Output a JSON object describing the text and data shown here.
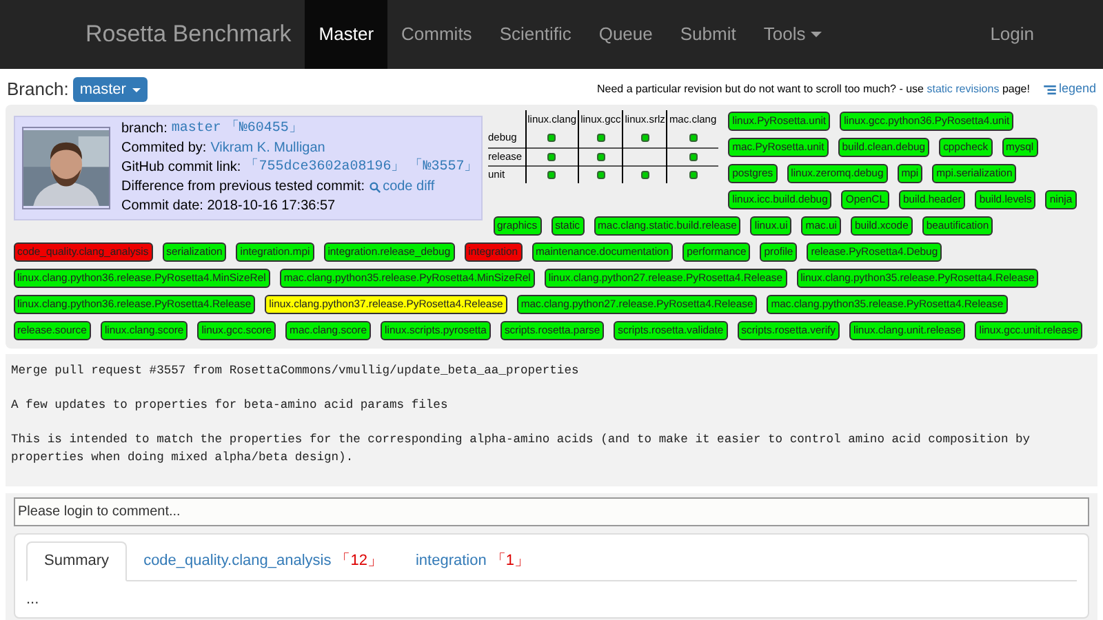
{
  "navbar": {
    "brand": "Rosetta Benchmark",
    "items": [
      {
        "label": "Master",
        "selected": true
      },
      {
        "label": "Commits",
        "selected": false
      },
      {
        "label": "Scientific",
        "selected": false
      },
      {
        "label": "Queue",
        "selected": false
      },
      {
        "label": "Submit",
        "selected": false
      },
      {
        "label": "Tools",
        "selected": false,
        "dropdown": true
      }
    ],
    "login": "Login"
  },
  "branch": {
    "label": "Branch:",
    "value": "master"
  },
  "revision_note": {
    "text": "Need a particular revision but do not want to scroll too much? - use",
    "link": "static revisions",
    "suffix": "page!"
  },
  "legend": "legend",
  "commit": {
    "branch_label": "branch:",
    "branch": "master",
    "branch_rev": "「№60455」",
    "committed_label": "Commited by:",
    "author": "Vikram K. Mulligan",
    "github_label": "GitHub commit link:",
    "hash": "「755dce3602a08196」",
    "pr": "「№3557」",
    "diff_label": "Difference from previous tested commit:",
    "diff_link": "code diff",
    "date": "Commit date: 2018-10-16 17:36:57"
  },
  "matrix": {
    "columns": [
      "linux.clang",
      "linux.gcc",
      "linux.srlz",
      "mac.clang"
    ],
    "rows": [
      {
        "label": "debug",
        "cells": [
          true,
          true,
          true,
          true
        ]
      },
      {
        "label": "release",
        "cells": [
          true,
          true,
          false,
          true
        ]
      },
      {
        "label": "unit",
        "cells": [
          true,
          true,
          true,
          true
        ]
      }
    ]
  },
  "tests": [
    {
      "label": "linux.PyRosetta.unit",
      "color": "#00ee00"
    },
    {
      "label": "linux.gcc.python36.PyRosetta4.unit",
      "color": "#00ee00"
    },
    {
      "label": "mac.PyRosetta.unit",
      "color": "#00ee00"
    },
    {
      "label": "build.clean.debug",
      "color": "#00ee00"
    },
    {
      "label": "cppcheck",
      "color": "#00ee00"
    },
    {
      "label": "mysql",
      "color": "#00ee00"
    },
    {
      "label": "postgres",
      "color": "#00ee00"
    },
    {
      "label": "linux.zeromq.debug",
      "color": "#00ee00"
    },
    {
      "label": "mpi",
      "color": "#00ee00"
    },
    {
      "label": "mpi.serialization",
      "color": "#00ee00"
    },
    {
      "label": "linux.icc.build.debug",
      "color": "#00ee00"
    },
    {
      "label": "OpenCL",
      "color": "#00ee00"
    },
    {
      "label": "build.header",
      "color": "#00ee00"
    },
    {
      "label": "build.levels",
      "color": "#00ee00"
    },
    {
      "label": "ninja",
      "color": "#00ee00"
    },
    {
      "label": "graphics",
      "color": "#00ee00"
    },
    {
      "label": "static",
      "color": "#00ee00"
    },
    {
      "label": "mac.clang.static.build.release",
      "color": "#00ee00"
    },
    {
      "label": "linux.ui",
      "color": "#00ee00"
    },
    {
      "label": "mac.ui",
      "color": "#00ee00"
    },
    {
      "label": "build.xcode",
      "color": "#00ee00"
    },
    {
      "label": "beautification",
      "color": "#00ee00"
    },
    {
      "label": "code_quality.clang_analysis",
      "color": "#ee0000"
    },
    {
      "label": "serialization",
      "color": "#00ee00"
    },
    {
      "label": "integration.mpi",
      "color": "#00ee00"
    },
    {
      "label": "integration.release_debug",
      "color": "#00ee00"
    },
    {
      "label": "integration",
      "color": "#ee0000"
    },
    {
      "label": "maintenance.documentation",
      "color": "#00ee00"
    },
    {
      "label": "performance",
      "color": "#00ee00"
    },
    {
      "label": "profile",
      "color": "#00ee00"
    },
    {
      "label": "release.PyRosetta4.Debug",
      "color": "#00ee00"
    },
    {
      "label": "linux.clang.python36.release.PyRosetta4.MinSizeRel",
      "color": "#00ee00"
    },
    {
      "label": "mac.clang.python35.release.PyRosetta4.MinSizeRel",
      "color": "#00ee00"
    },
    {
      "label": "linux.clang.python27.release.PyRosetta4.Release",
      "color": "#00ee00"
    },
    {
      "label": "linux.clang.python35.release.PyRosetta4.Release",
      "color": "#00ee00"
    },
    {
      "label": "linux.clang.python36.release.PyRosetta4.Release",
      "color": "#00ee00"
    },
    {
      "label": "linux.clang.python37.release.PyRosetta4.Release",
      "color": "#ffff00"
    },
    {
      "label": "mac.clang.python27.release.PyRosetta4.Release",
      "color": "#00ee00"
    },
    {
      "label": "mac.clang.python35.release.PyRosetta4.Release",
      "color": "#00ee00"
    },
    {
      "label": "release.source",
      "color": "#00ee00"
    },
    {
      "label": "linux.clang.score",
      "color": "#00ee00"
    },
    {
      "label": "linux.gcc.score",
      "color": "#00ee00"
    },
    {
      "label": "mac.clang.score",
      "color": "#00ee00"
    },
    {
      "label": "linux.scripts.pyrosetta",
      "color": "#00ee00"
    },
    {
      "label": "scripts.rosetta.parse",
      "color": "#00ee00"
    },
    {
      "label": "scripts.rosetta.validate",
      "color": "#00ee00"
    },
    {
      "label": "scripts.rosetta.verify",
      "color": "#00ee00"
    },
    {
      "label": "linux.clang.unit.release",
      "color": "#00ee00"
    },
    {
      "label": "linux.gcc.unit.release",
      "color": "#00ee00"
    }
  ],
  "message": [
    "Merge pull request #3557 from RosettaCommons/vmullig/update_beta_aa_properties",
    "A few updates to properties for beta-amino acid params files",
    "This is intended to match the properties for the corresponding alpha-amino acids (and to make it easier to control amino acid composition by properties when doing mixed alpha/beta design)."
  ],
  "comment": {
    "placeholder": "Please login to comment..."
  },
  "tabs": [
    {
      "label": "Summary",
      "selected": true
    },
    {
      "label": "code_quality.clang_analysis",
      "count": "「12」",
      "selected": false
    },
    {
      "label": "integration",
      "count": "「1」",
      "selected": false
    }
  ],
  "tab_content": "..."
}
